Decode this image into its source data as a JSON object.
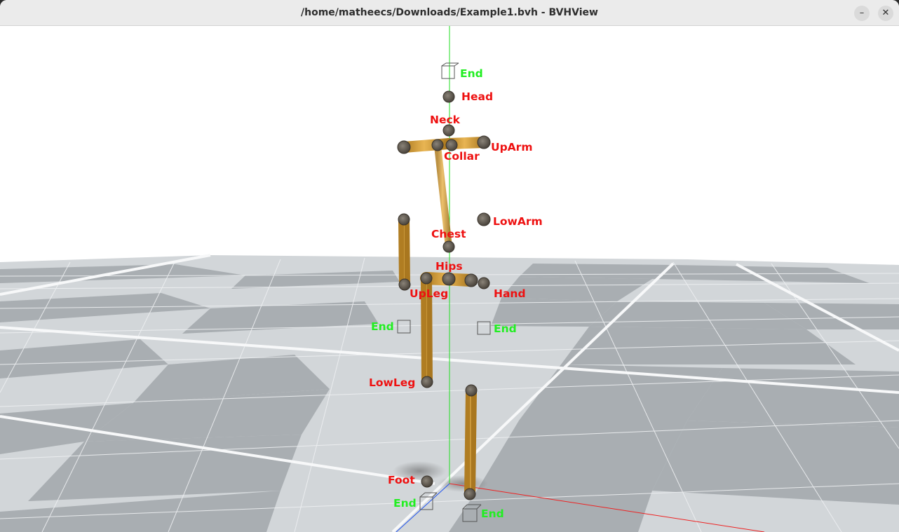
{
  "window": {
    "title": "/home/matheecs/Downloads/Example1.bvh - BVHView",
    "minimize_glyph": "–",
    "close_glyph": "✕"
  },
  "viewport": {
    "joint_labels": {
      "end_head": "End",
      "head": "Head",
      "neck": "Neck",
      "up_arm": "UpArm",
      "collar": "Collar",
      "low_arm": "LowArm",
      "chest": "Chest",
      "hips": "Hips",
      "up_leg": "UpLeg",
      "hand": "Hand",
      "end_left_hand": "End",
      "end_right_hand": "End",
      "low_leg": "LowLeg",
      "foot": "Foot",
      "end_left_foot": "End",
      "end_right_foot": "End"
    },
    "colors": {
      "joint_label": "#ee1111",
      "end_label": "#22ee22",
      "bone": "#d9a441",
      "floor_light": "#d2d6d9",
      "floor_dark": "#a9aeb2",
      "y_axis": "#22dd22",
      "x_axis": "#ee2222",
      "z_axis": "#2255ee"
    }
  }
}
